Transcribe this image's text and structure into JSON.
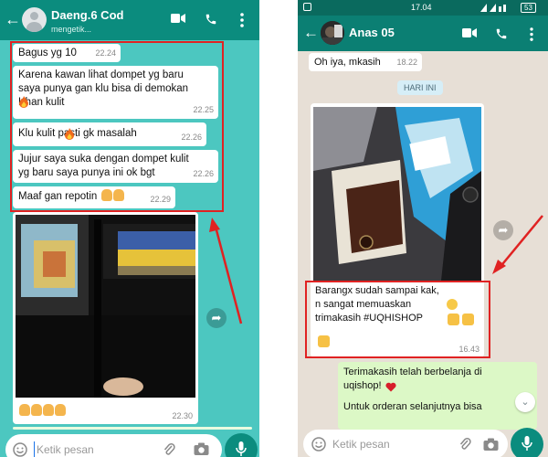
{
  "left": {
    "contact_name": "Daeng.6 Cod",
    "status": "mengetik...",
    "messages": [
      {
        "text": "Bagus yg 10",
        "time": "22.24"
      },
      {
        "text": "Karena kawan lihat dompet yg baru\nsaya punya gan klu bisa di demokan\nKhan kulit",
        "time": "22.25"
      },
      {
        "text": "Klu kulit  pasti gk masalah",
        "time": "22.26"
      },
      {
        "text": "Jujur saya suka dengan dompet kulit\nyg baru saya punya ini ok bgt",
        "time": "22.26"
      },
      {
        "text": "Maaf gan repotin",
        "time": "22.29"
      }
    ],
    "photo_time": "22.30",
    "input_placeholder": "Ketik pesan",
    "icons": [
      "back-arrow-icon",
      "video-call-icon",
      "phone-icon",
      "more-vert-icon",
      "emoji-icon",
      "attach-icon",
      "camera-icon",
      "mic-icon",
      "forward-icon"
    ]
  },
  "right": {
    "status_time": "17.04",
    "battery": "53",
    "contact_name": "Anas 05",
    "messages_in": [
      {
        "text": "Oh iya, mkasih",
        "time": "18.22"
      }
    ],
    "date_label": "HARI INI",
    "photo_caption": "Barangx sudah sampai kak,\nn sangat memuaskan\ntrimakasih #UQHISHOP",
    "photo_time": "16.43",
    "reply_1": "Terimakasih telah berbelanja di\nuqishop!",
    "reply_2": "Untuk orderan selanjutnya bisa",
    "input_placeholder": "Ketik pesan",
    "icons": [
      "back-arrow-icon",
      "video-call-icon",
      "phone-icon",
      "more-vert-icon",
      "emoji-icon",
      "attach-icon",
      "camera-icon",
      "mic-icon",
      "forward-icon",
      "scroll-down-icon"
    ]
  },
  "colors": {
    "header_green": "#0b8c7e",
    "chat_bg_left": "#4cc7c0",
    "chat_bg_right": "#e7dfd6",
    "outgoing_bubble": "#dcf8c6",
    "highlight_red": "#e02222"
  }
}
